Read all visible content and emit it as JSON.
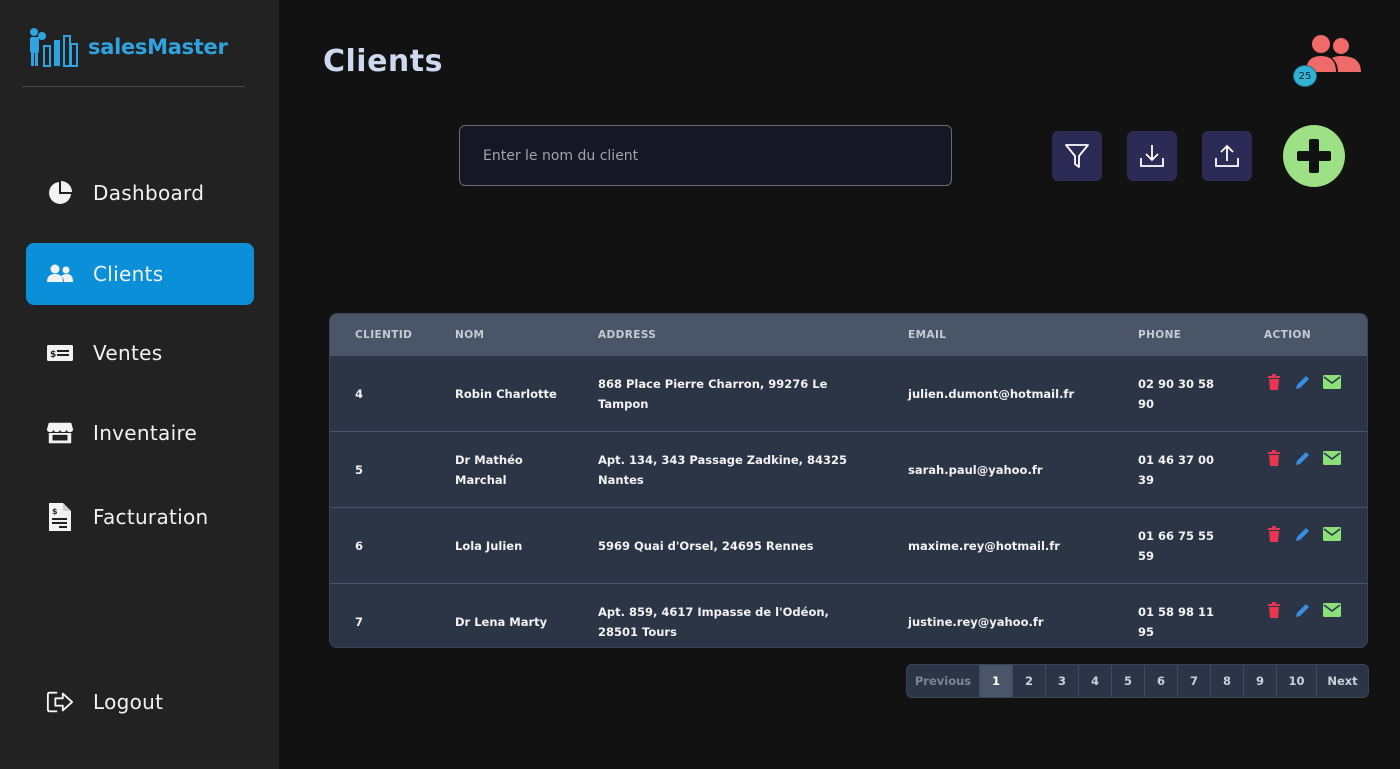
{
  "app": {
    "name": "salesMaster",
    "brand_color": "#2ea3e0",
    "accent": "#0b8fd9"
  },
  "sidebar": {
    "items": [
      {
        "label": "Dashboard",
        "icon": "pie-chart-icon",
        "active": false
      },
      {
        "label": "Clients",
        "icon": "users-icon",
        "active": true
      },
      {
        "label": "Ventes",
        "icon": "money-bill-icon",
        "active": false
      },
      {
        "label": "Inventaire",
        "icon": "store-icon",
        "active": false
      },
      {
        "label": "Facturation",
        "icon": "invoice-icon",
        "active": false
      }
    ],
    "logout": {
      "label": "Logout",
      "icon": "logout-icon"
    }
  },
  "header": {
    "title": "Clients",
    "user_count": "25",
    "user_icon": "users-group-icon",
    "user_icon_color": "#f06a6a"
  },
  "search": {
    "placeholder": "Enter le nom du client",
    "value": ""
  },
  "toolbar": {
    "filter_icon": "filter-icon",
    "download_icon": "download-icon",
    "upload_icon": "upload-icon",
    "add_icon": "plus-icon",
    "add_color": "#9ee085"
  },
  "table": {
    "columns": [
      "CLIENTID",
      "NOM",
      "ADDRESS",
      "EMAIL",
      "PHONE",
      "ACTION"
    ],
    "rows": [
      {
        "id": "4",
        "nom": "Robin Charlotte",
        "address": "868 Place Pierre Charron, 99276 Le Tampon",
        "email": "julien.dumont@hotmail.fr",
        "phone": "02 90 30 58 90"
      },
      {
        "id": "5",
        "nom": "Dr Mathéo Marchal",
        "address": "Apt. 134, 343 Passage Zadkine, 84325 Nantes",
        "email": "sarah.paul@yahoo.fr",
        "phone": "01 46 37 00 39"
      },
      {
        "id": "6",
        "nom": "Lola Julien",
        "address": "5969 Quai d'Orsel, 24695 Rennes",
        "email": "maxime.rey@hotmail.fr",
        "phone": "01 66 75 55 59"
      },
      {
        "id": "7",
        "nom": "Dr Lena Marty",
        "address": "Apt. 859, 4617 Impasse de l'Odéon, 28501 Tours",
        "email": "justine.rey@yahoo.fr",
        "phone": "01 58 98 11 95"
      }
    ],
    "action_icons": {
      "delete": "trash-icon",
      "edit": "pencil-icon",
      "email": "envelope-icon"
    },
    "action_colors": {
      "delete": "#e8364f",
      "edit": "#3b8fe0",
      "email": "#8be07a"
    }
  },
  "pagination": {
    "previous": "Previous",
    "pages": [
      "1",
      "2",
      "3",
      "4",
      "5",
      "6",
      "7",
      "8",
      "9",
      "10"
    ],
    "current": "1",
    "next": "Next"
  }
}
